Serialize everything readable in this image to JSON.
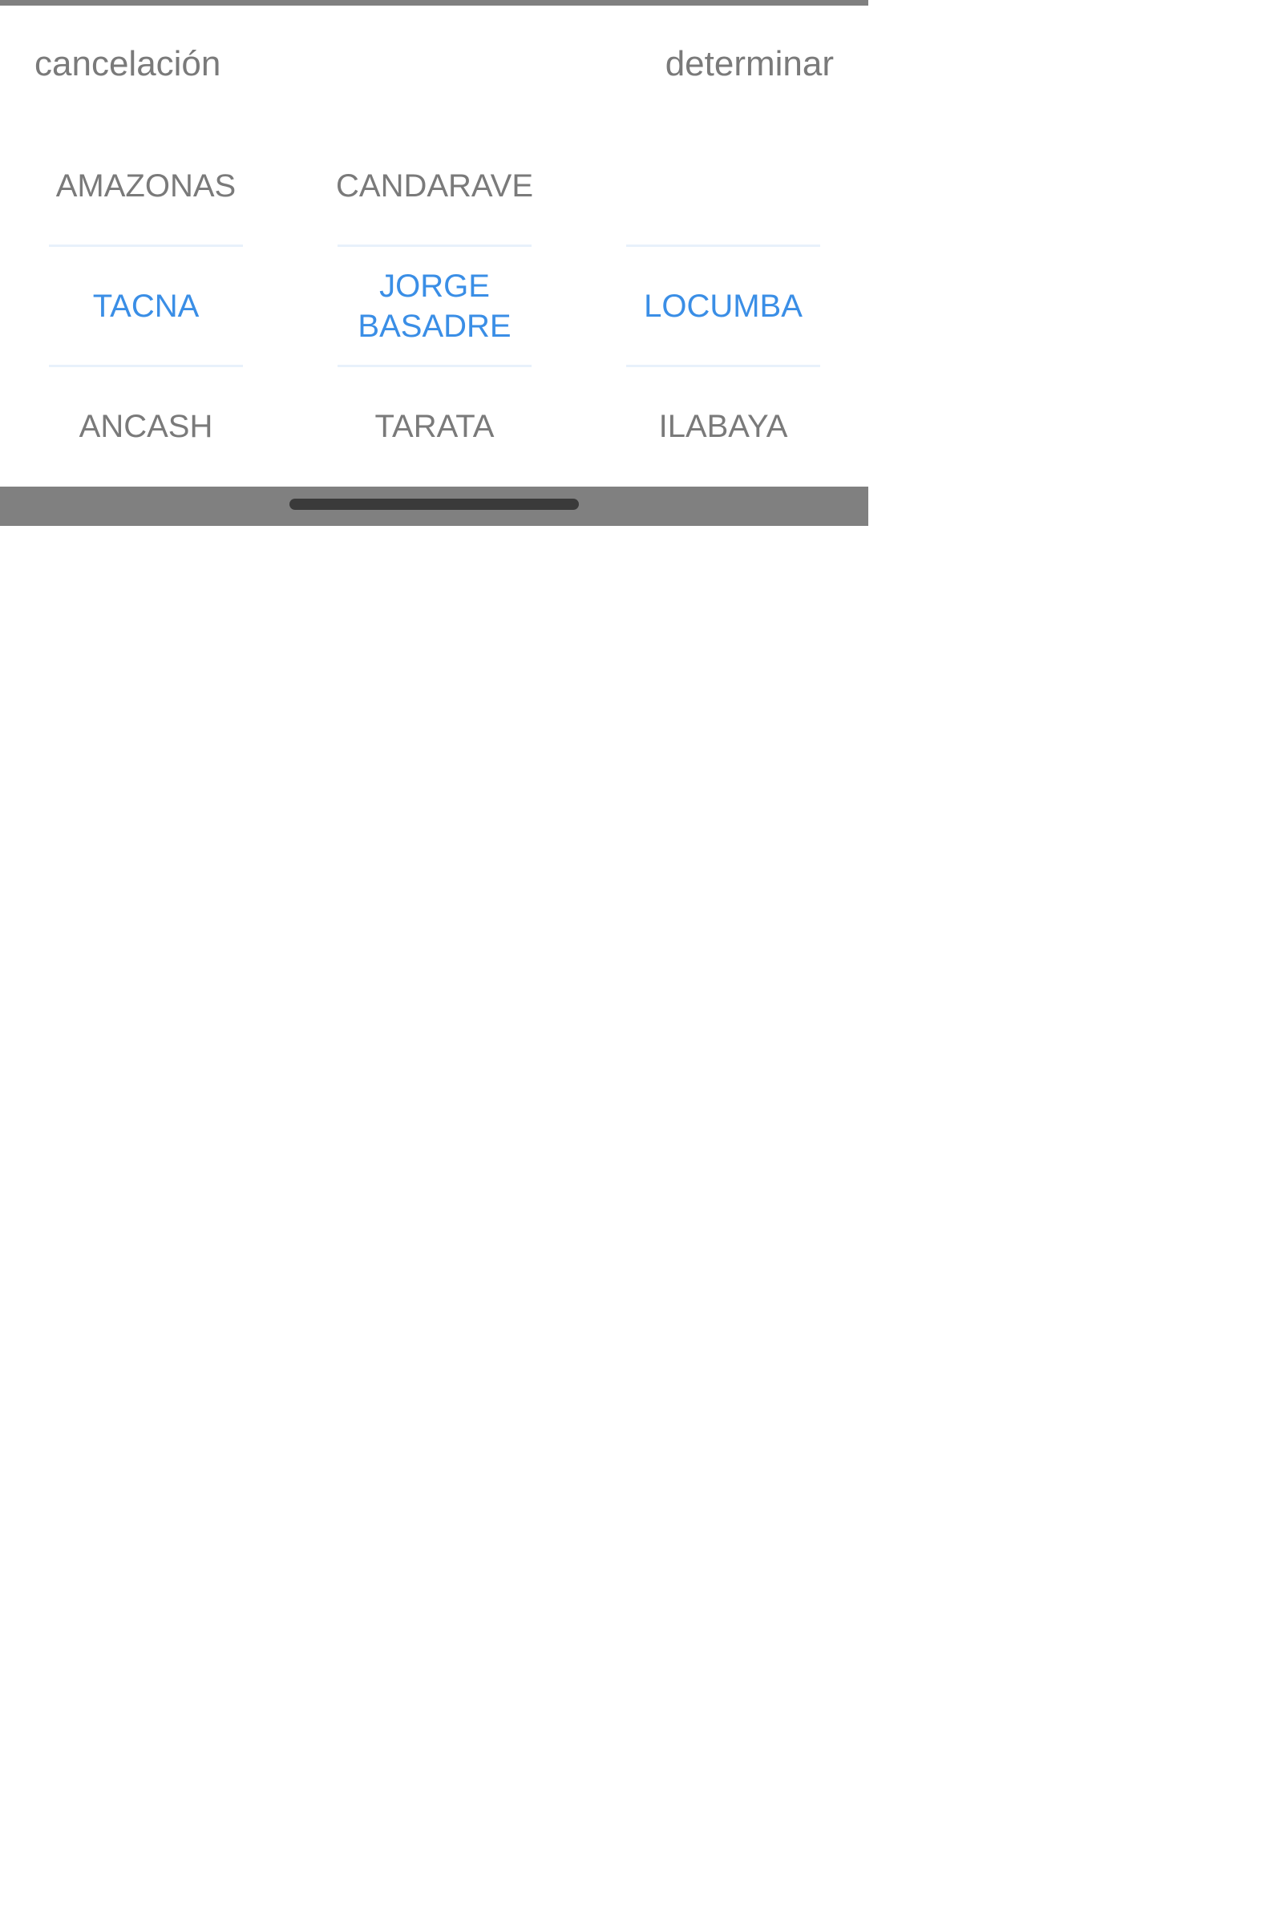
{
  "toolbar": {
    "cancel_label": "cancelación",
    "confirm_label": "determinar"
  },
  "picker": {
    "columns": [
      {
        "above": "AMAZONAS",
        "selected": "TACNA",
        "below": "ANCASH"
      },
      {
        "above": "CANDARAVE",
        "selected": "JORGE BASADRE",
        "below": "TARATA"
      },
      {
        "above": "",
        "selected": "LOCUMBA",
        "below": "ILABAYA"
      }
    ]
  },
  "colors": {
    "text_normal": "#7a7a7a",
    "text_selected": "#3a8ee6",
    "divider": "#e8f1fb",
    "system_bar": "#808080",
    "home_indicator": "#3a3a3a"
  }
}
